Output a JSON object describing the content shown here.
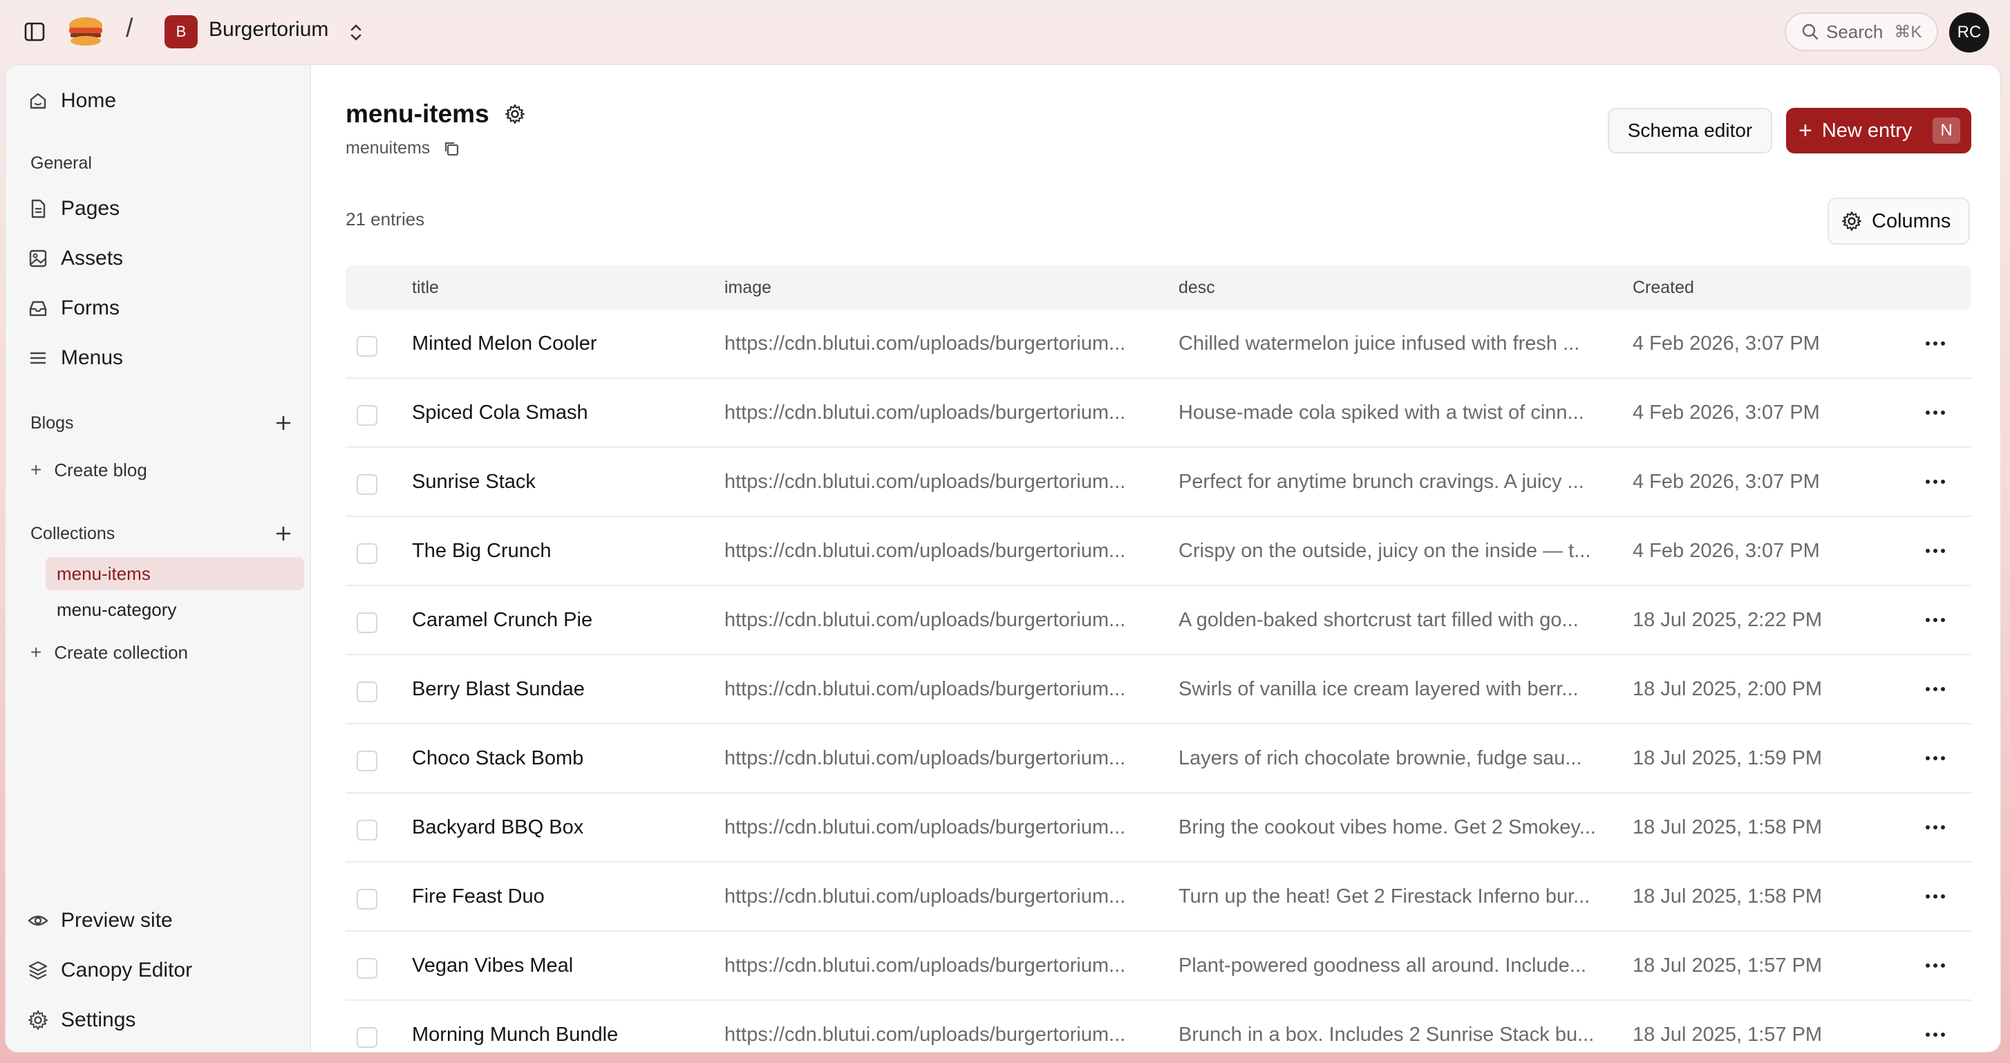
{
  "topbar": {
    "workspace_initial": "B",
    "workspace_name": "Burgertorium",
    "separator": "/",
    "search_label": "Search",
    "search_shortcut": "⌘K",
    "user_initials": "RC"
  },
  "sidebar": {
    "home": "Home",
    "general_label": "General",
    "general_items": [
      {
        "label": "Pages",
        "icon": "file-icon"
      },
      {
        "label": "Assets",
        "icon": "image-icon"
      },
      {
        "label": "Forms",
        "icon": "inbox-icon"
      },
      {
        "label": "Menus",
        "icon": "menu-icon"
      }
    ],
    "blogs_label": "Blogs",
    "create_blog": "Create blog",
    "collections_label": "Collections",
    "collections": [
      {
        "label": "menu-items",
        "active": true
      },
      {
        "label": "menu-category",
        "active": false
      }
    ],
    "create_collection": "Create collection",
    "bottom_items": [
      {
        "label": "Preview site",
        "icon": "eye-icon"
      },
      {
        "label": "Canopy Editor",
        "icon": "layers-icon"
      },
      {
        "label": "Settings",
        "icon": "gear-icon"
      }
    ]
  },
  "main": {
    "title": "menu-items",
    "slug": "menuitems",
    "schema_editor": "Schema editor",
    "new_entry": "New entry",
    "new_entry_shortcut": "N",
    "entry_count": "21 entries",
    "columns_button": "Columns",
    "headers": {
      "title": "title",
      "image": "image",
      "desc": "desc",
      "created": "Created"
    },
    "rows": [
      {
        "title": "Minted Melon Cooler",
        "image": "https://cdn.blutui.com/uploads/burgertorium...",
        "desc": "Chilled watermelon juice infused with fresh ...",
        "created": "4 Feb 2026, 3:07 PM"
      },
      {
        "title": "Spiced Cola Smash",
        "image": "https://cdn.blutui.com/uploads/burgertorium...",
        "desc": "House-made cola spiked with a twist of cinn...",
        "created": "4 Feb 2026, 3:07 PM"
      },
      {
        "title": "Sunrise Stack",
        "image": "https://cdn.blutui.com/uploads/burgertorium...",
        "desc": "Perfect for anytime brunch cravings. A juicy ...",
        "created": "4 Feb 2026, 3:07 PM"
      },
      {
        "title": "The Big Crunch",
        "image": "https://cdn.blutui.com/uploads/burgertorium...",
        "desc": "Crispy on the outside, juicy on the inside — t...",
        "created": "4 Feb 2026, 3:07 PM"
      },
      {
        "title": "Caramel Crunch Pie",
        "image": "https://cdn.blutui.com/uploads/burgertorium...",
        "desc": "A golden-baked shortcrust tart filled with go...",
        "created": "18 Jul 2025, 2:22 PM"
      },
      {
        "title": "Berry Blast Sundae",
        "image": "https://cdn.blutui.com/uploads/burgertorium...",
        "desc": "Swirls of vanilla ice cream layered with berr...",
        "created": "18 Jul 2025, 2:00 PM"
      },
      {
        "title": "Choco Stack Bomb",
        "image": "https://cdn.blutui.com/uploads/burgertorium...",
        "desc": "Layers of rich chocolate brownie, fudge sau...",
        "created": "18 Jul 2025, 1:59 PM"
      },
      {
        "title": "Backyard BBQ Box",
        "image": "https://cdn.blutui.com/uploads/burgertorium...",
        "desc": "Bring the cookout vibes home. Get 2 Smokey...",
        "created": "18 Jul 2025, 1:58 PM"
      },
      {
        "title": "Fire Feast Duo",
        "image": "https://cdn.blutui.com/uploads/burgertorium...",
        "desc": "Turn up the heat! Get 2 Firestack Inferno bur...",
        "created": "18 Jul 2025, 1:58 PM"
      },
      {
        "title": "Vegan Vibes Meal",
        "image": "https://cdn.blutui.com/uploads/burgertorium...",
        "desc": "Plant-powered goodness all around. Include...",
        "created": "18 Jul 2025, 1:57 PM"
      },
      {
        "title": "Morning Munch Bundle",
        "image": "https://cdn.blutui.com/uploads/burgertorium...",
        "desc": "Brunch in a box. Includes 2 Sunrise Stack bu...",
        "created": "18 Jul 2025, 1:57 PM"
      }
    ]
  },
  "colors": {
    "brand": "#a01d1d",
    "active_bg": "#f1dfdf",
    "active_text": "#8b1b1b"
  }
}
